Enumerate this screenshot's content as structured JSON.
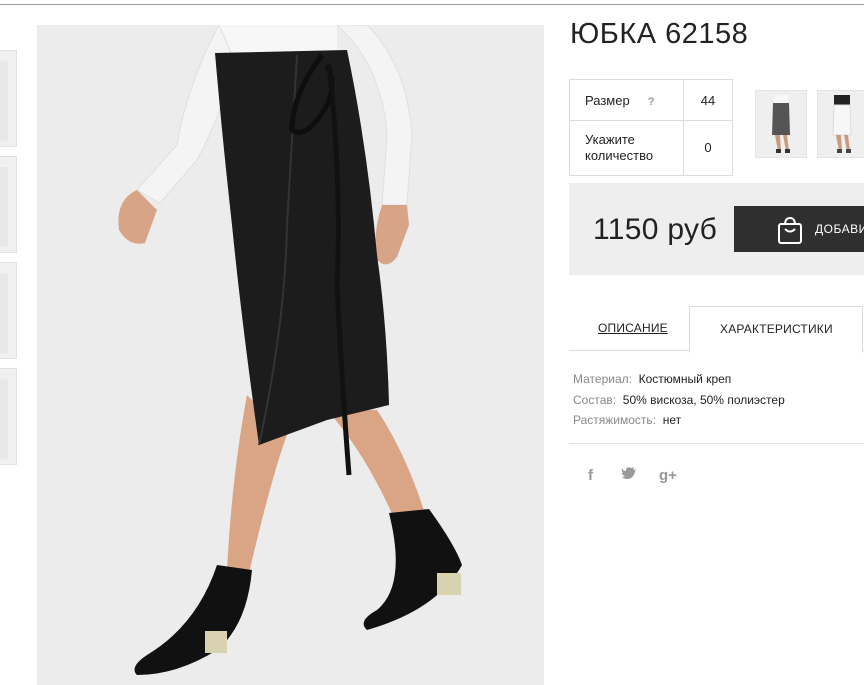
{
  "product": {
    "title": "ЮБКА 62158",
    "options": [
      {
        "label": "Размер",
        "help": "?",
        "value": "44"
      },
      {
        "label": "Укажите количество",
        "value": "0"
      }
    ],
    "price": "1150 руб",
    "add_button_label": "ДОБАВИ"
  },
  "tabs": [
    {
      "label": "ОПИСАНИЕ",
      "active": false
    },
    {
      "label": "ХАРАКТЕРИСТИКИ",
      "active": true
    }
  ],
  "specs": [
    {
      "key": "Материал:",
      "value": "Костюмный креп"
    },
    {
      "key": "Состав:",
      "value": "50% вискоза, 50% полиэстер"
    },
    {
      "key": "Растяжимость:",
      "value": "нет"
    }
  ],
  "social": [
    {
      "icon": "facebook-icon",
      "glyph": "f"
    },
    {
      "icon": "twitter-icon",
      "glyph": "t"
    },
    {
      "icon": "google-plus-icon",
      "glyph": "g+"
    }
  ],
  "colors": {
    "button_bg": "#2f2f2f",
    "price_bar_bg": "#eeeeee",
    "skirt": "#1c1c1c"
  }
}
